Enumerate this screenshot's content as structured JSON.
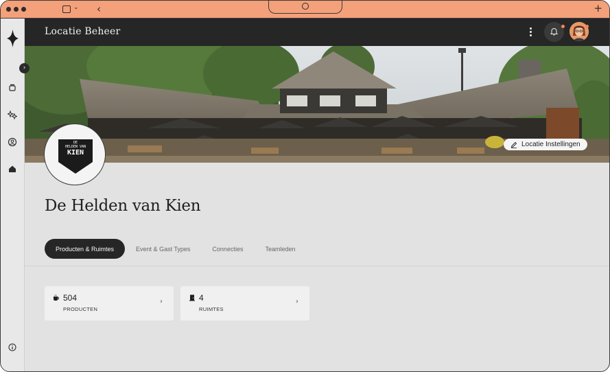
{
  "header": {
    "title": "Locatie Beheer"
  },
  "banner": {
    "settings_label": "Locatie Instellingen"
  },
  "venue": {
    "name": "De Helden van Kien",
    "logo_line1": "DE",
    "logo_line2": "HELDEN VAN",
    "logo_line3": "KIEN"
  },
  "tabs": [
    {
      "label": "Producten & Ruimtes",
      "active": true
    },
    {
      "label": "Event & Gast Types",
      "active": false
    },
    {
      "label": "Connecties",
      "active": false
    },
    {
      "label": "Teamleden",
      "active": false
    }
  ],
  "stats": [
    {
      "value": "504",
      "label": "PRODUCTEN",
      "icon": "coffee-cup-icon"
    },
    {
      "value": "4",
      "label": "RUIMTES",
      "icon": "door-icon"
    }
  ],
  "colors": {
    "accent": "#f4a07a",
    "header_bg": "#262626",
    "notification_dot": "#f4875a"
  }
}
